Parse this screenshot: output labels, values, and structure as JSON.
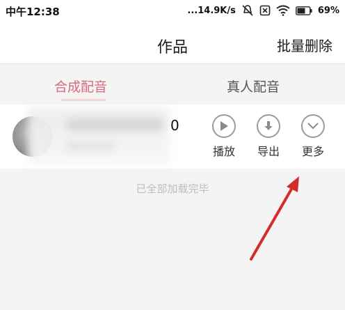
{
  "status_bar": {
    "time": "中午12:38",
    "speed": "...14.9K/s",
    "battery": "69%"
  },
  "nav": {
    "title": "作品",
    "batch_delete": "批量删除"
  },
  "tabs": [
    {
      "label": "合成配音",
      "active": true
    },
    {
      "label": "真人配音",
      "active": false
    }
  ],
  "work_item": {
    "title_visible_tail": "0",
    "actions": {
      "play": "播放",
      "export": "导出",
      "more": "更多"
    }
  },
  "list_end_text": "已全部加载完毕",
  "colors": {
    "active_tab": "#d9697d",
    "arrow": "#d42b2b"
  }
}
